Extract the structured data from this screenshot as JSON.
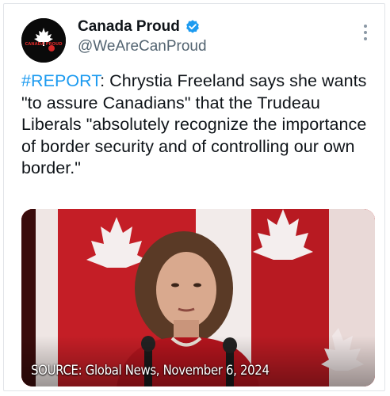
{
  "author": {
    "display_name": "Canada Proud",
    "handle": "@WeAreCanProud",
    "avatar_text": "CANADA PROUD",
    "verified_icon": "verified-badge-icon"
  },
  "tweet": {
    "hashtag": "#REPORT",
    "body": ": Chrystia Freeland says she wants \"to assure Canadians\" that the Trudeau Liberals \"absolutely recognize the importance of border security and of controlling our own border.\""
  },
  "media": {
    "caption": "SOURCE: Global News, November 6, 2024"
  },
  "colors": {
    "link": "#1d9bf0",
    "verified": "#1d9bf0",
    "flag_red": "#c8202a"
  },
  "icons": {
    "more": "more-dots-icon"
  }
}
